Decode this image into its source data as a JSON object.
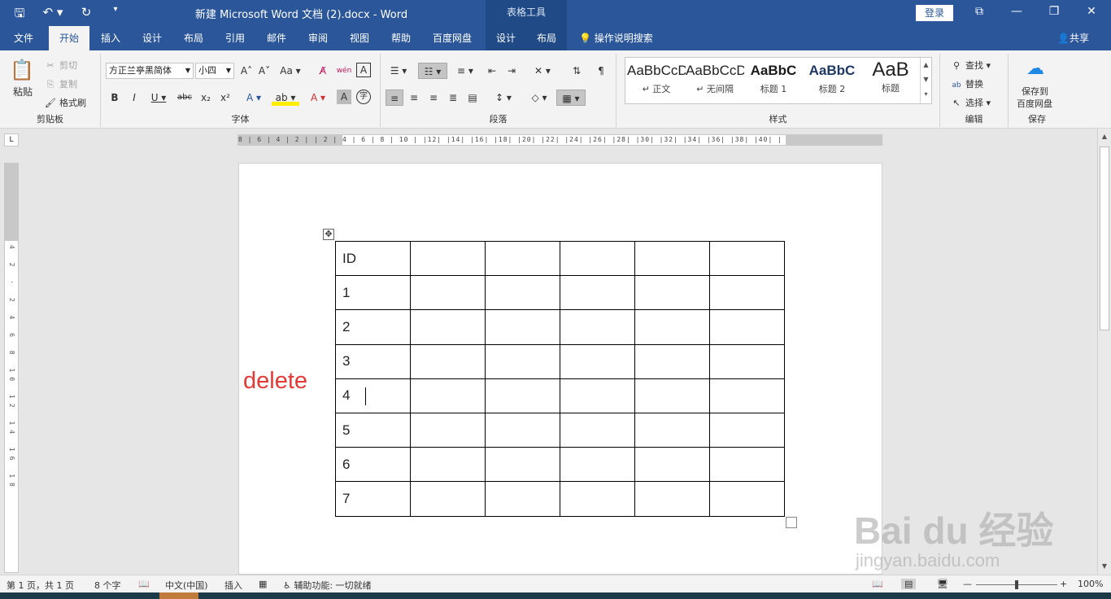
{
  "titlebar": {
    "title": "新建 Microsoft Word 文档 (2).docx  -  Word",
    "context_tab": "表格工具",
    "login": "登录",
    "qat": {
      "save": "🖫",
      "undo": "↶ ▾",
      "redo": "↻",
      "customize": "▾"
    },
    "win": {
      "ribbon_opts": "⧉",
      "minimize": "—",
      "maximize": "❐",
      "close": "✕"
    }
  },
  "tabs": {
    "file": "文件",
    "home": "开始",
    "insert": "插入",
    "design": "设计",
    "layout": "布局",
    "references": "引用",
    "mailings": "邮件",
    "review": "审阅",
    "view": "视图",
    "help": "帮助",
    "baidu": "百度网盘",
    "table_design": "设计",
    "table_layout": "布局",
    "tellme": "操作说明搜索",
    "share": "共享"
  },
  "ribbon": {
    "clipboard": {
      "paste": "粘贴",
      "cut": "剪切",
      "copy": "复制",
      "format_painter": "格式刷",
      "label": "剪贴板"
    },
    "font": {
      "name": "方正兰亭黑简体",
      "size": "小四",
      "label": "字体",
      "grow": "A˄",
      "shrink": "A˅",
      "case": "Aa ▾",
      "clear": "A̸",
      "phonetic": "wén",
      "border": "A",
      "bold": "B",
      "italic": "I",
      "underline": "U ▾",
      "strike": "abc",
      "sub": "x₂",
      "sup": "x²",
      "effects": "A ▾",
      "highlight": "ab ▾",
      "color": "A ▾",
      "shade": "A",
      "enclose": "字"
    },
    "paragraph": {
      "label": "段落"
    },
    "styles": {
      "label": "样式",
      "items": [
        {
          "sample": "AaBbCcDd",
          "name": "↵ 正文"
        },
        {
          "sample": "AaBbCcDd",
          "name": "↵ 无间隔"
        },
        {
          "sample": "AaBbC",
          "name": "标题 1"
        },
        {
          "sample": "AaBbC",
          "name": "标题 2"
        },
        {
          "sample": "AaB",
          "name": "标题"
        }
      ]
    },
    "editing": {
      "find": "查找",
      "replace": "替换",
      "select": "选择",
      "label": "编辑"
    },
    "save": {
      "line1": "保存到",
      "line2": "百度网盘",
      "label": "保存"
    }
  },
  "ruler": {
    "h": "8 | 6 | 4 | 2 |   | 2 | 4 |   6 | 8 | 10 |   |12| |14| |16| |18| |20| |22| |24| |26| |28| |30| |32| |34| |36| |38| |40| |",
    "v": "4 2 · 2 4 6 8 10 12 14 16 18"
  },
  "document": {
    "annotation": "delete",
    "table_rows": [
      [
        "ID",
        "",
        "",
        "",
        "",
        ""
      ],
      [
        "1",
        "",
        "",
        "",
        "",
        ""
      ],
      [
        "2",
        "",
        "",
        "",
        "",
        ""
      ],
      [
        "3",
        "",
        "",
        "",
        "",
        ""
      ],
      [
        "4",
        "",
        "",
        "",
        "",
        ""
      ],
      [
        "5",
        "",
        "",
        "",
        "",
        ""
      ],
      [
        "6",
        "",
        "",
        "",
        "",
        ""
      ],
      [
        "7",
        "",
        "",
        "",
        "",
        ""
      ]
    ]
  },
  "status": {
    "page": "第 1 页，共 1 页",
    "words": "8 个字",
    "language": "中文(中国)",
    "insert_mode": "插入",
    "accessibility": "辅助功能: 一切就绪",
    "zoom": "100%"
  },
  "watermark": {
    "main": "Bai du 经验",
    "sub": "jingyan.baidu.com"
  }
}
